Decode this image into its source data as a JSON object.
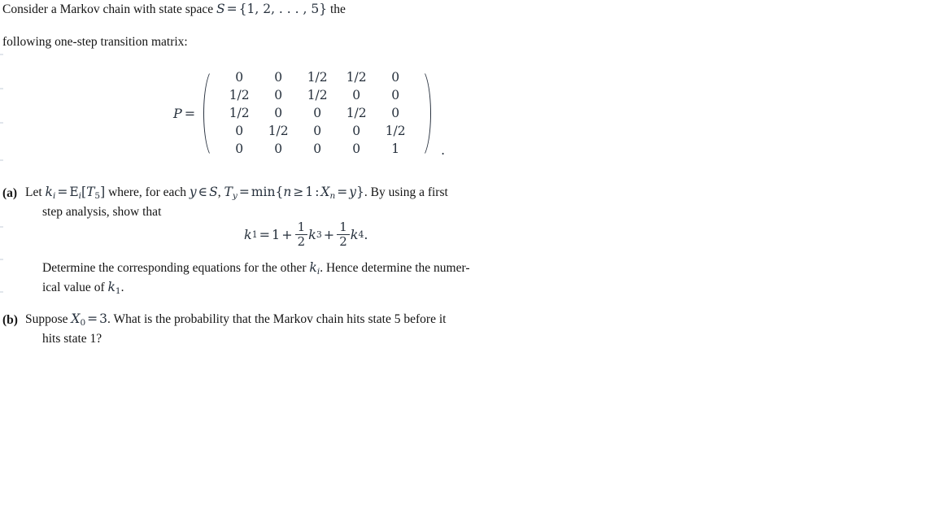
{
  "document": {
    "intro": {
      "line1_before_math": "Consider a Markov chain with state space ",
      "state_space_symbol": "S",
      "equals": "=",
      "state_space_value": "{1, 2, . . . , 5}",
      "line1_after_math": " the",
      "line2": "following one-step transition matrix:"
    },
    "matrix": {
      "label": "P",
      "equals": "=",
      "trailing_punctuation": ".",
      "rows": [
        [
          "0",
          "0",
          "1/2",
          "1/2",
          "0"
        ],
        [
          "1/2",
          "0",
          "1/2",
          "0",
          "0"
        ],
        [
          "1/2",
          "0",
          "0",
          "1/2",
          "0"
        ],
        [
          "0",
          "1/2",
          "0",
          "0",
          "1/2"
        ],
        [
          "0",
          "0",
          "0",
          "0",
          "1"
        ]
      ]
    },
    "items": [
      {
        "marker": "(a)",
        "line1": {
          "t1": "Let ",
          "k_sym": "k",
          "k_sub": "i",
          "eq1": "=",
          "E_sym": "E",
          "E_sub": "i",
          "bracket_open": "[",
          "T_sym": "T",
          "T_sub": "5",
          "bracket_close": "]",
          "t2": " where, for each ",
          "y_sym": "y",
          "in_sym": "∈",
          "S_sym": "S",
          "comma1": ", ",
          "Ty_sym": "T",
          "Ty_sub": "y",
          "eq2": "=",
          "min_txt": "min",
          "brace_open": "{",
          "n_sym": "n",
          "geq": "≥",
          "one": "1",
          "colon": ":",
          "X_sym": "X",
          "X_sub": "n",
          "eq3": "=",
          "y_sym2": "y",
          "brace_close": "}",
          "t3": ". By using a first"
        },
        "line2": "step analysis, show that",
        "line3_a": "Determine the corresponding equations for the other ",
        "line3_k": "k",
        "line3_k_sub": "i",
        "line3_b": ". Hence determine the numer-",
        "line4_a": "ical value of ",
        "line4_k": "k",
        "line4_k_sub": "1",
        "line4_b": "."
      },
      {
        "marker": "(b)",
        "line1_a": "Suppose ",
        "line1_X": "X",
        "line1_X_sub": "0",
        "line1_eq": "=",
        "line1_val": "3",
        "line1_b": ". What is the probability that the Markov chain hits state 5 before it",
        "line2": "hits state 1?"
      }
    ],
    "display_equation": {
      "lhs_sym": "k",
      "lhs_sub": "1",
      "equals": "=",
      "term0": "1",
      "plus1": "+",
      "frac1_num": "1",
      "frac1_den": "2",
      "term1_sym": "k",
      "term1_sub": "3",
      "plus2": "+",
      "frac2_num": "1",
      "frac2_den": "2",
      "term2_sym": "k",
      "term2_sub": "4",
      "period": "."
    }
  }
}
